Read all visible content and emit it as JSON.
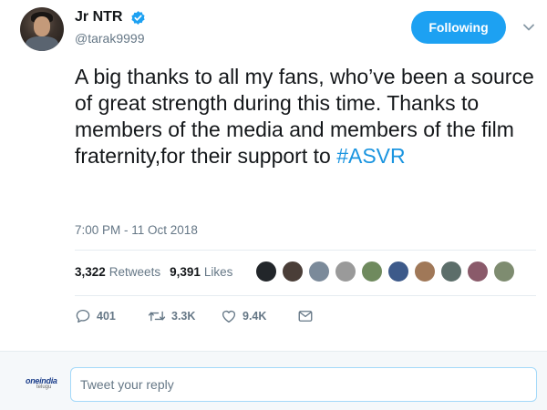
{
  "author": {
    "display_name": "Jr NTR",
    "handle": "@tarak9999",
    "verified": true
  },
  "follow_button": {
    "label": "Following",
    "color": "#1da1f2"
  },
  "tweet": {
    "text_before": "A big thanks to all my fans, who’ve been a source of great strength during this time. Thanks to members of the media and members of the film fraternity,for their support to ",
    "hashtag": "#ASVR",
    "timestamp": "7:00 PM - 11 Oct 2018"
  },
  "stats": {
    "retweets_count": "3,322",
    "retweets_label": "Retweets",
    "likes_count": "9,391",
    "likes_label": "Likes"
  },
  "actions": {
    "reply_count": "401",
    "retweet_count": "3.3K",
    "like_count": "9.4K"
  },
  "reply_box": {
    "placeholder": "Tweet your reply",
    "logo_text": "oneindia",
    "logo_subtext": "telugu"
  },
  "icons": {
    "verified": "verified-badge-icon",
    "chevron": "chevron-down-icon",
    "reply": "reply-icon",
    "retweet": "retweet-icon",
    "like": "heart-icon",
    "message": "envelope-icon"
  },
  "colors": {
    "accent": "#1da1f2",
    "hashtag": "#1b95e0",
    "muted": "#657786"
  }
}
